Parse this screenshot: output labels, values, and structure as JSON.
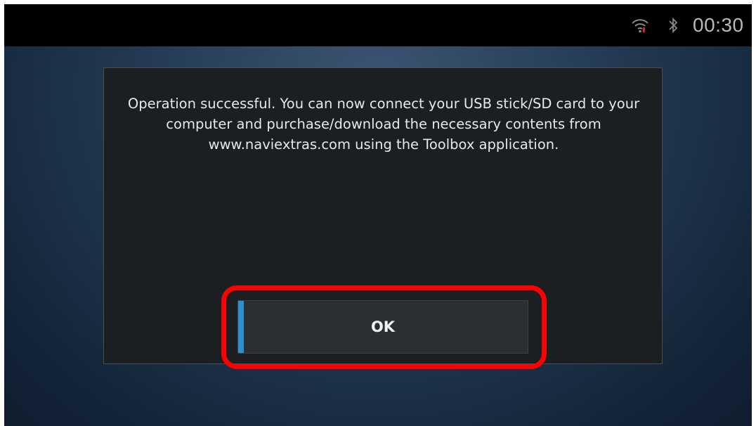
{
  "status_bar": {
    "time": "00:30",
    "icons": [
      "wifi-icon",
      "bluetooth-icon"
    ]
  },
  "dialog": {
    "message": "Operation successful. You can now connect your USB stick/SD card to your computer and purchase/download the necessary contents from www.naviextras.com using the Toolbox application.",
    "ok_label": "OK"
  },
  "colors": {
    "accent": "#2f8fd0",
    "highlight": "#ff0000",
    "dialog_background": "#1c1f21",
    "status_bar_background": "#000000"
  }
}
